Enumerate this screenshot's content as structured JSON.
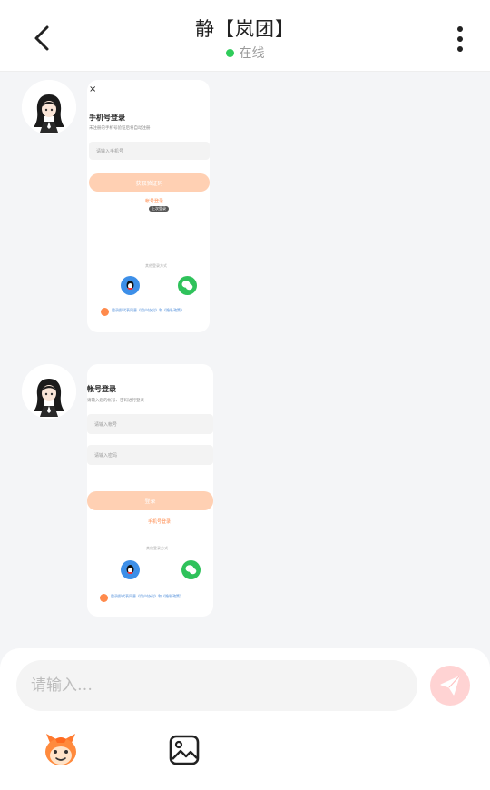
{
  "header": {
    "title": "静【岚团】",
    "status": "在线",
    "status_color": "#2fcc5a",
    "back_icon": "chevron-left-icon",
    "more_icon": "more-vertical-icon"
  },
  "messages": [
    {
      "avatar_icon": "anime-girl-avatar",
      "screenshot": {
        "close_glyph": "×",
        "heading": "手机号登录",
        "subtitle": "未注册的手机号验证后将自动注册",
        "phone_placeholder": "请输入手机号",
        "submit_label": "获取验证码",
        "alt_login": "帐号登录",
        "alt_tag": "上次登录",
        "divider_text": "其他登录方式",
        "agreement": "登录即代表同意《用户协议》和《隐私政策》"
      }
    },
    {
      "avatar_icon": "anime-girl-avatar",
      "screenshot": {
        "heading": "帐号登录",
        "subtitle": "请输入您的帐号、密码进行登录",
        "account_placeholder": "请输入帐号",
        "password_placeholder": "请输入密码",
        "submit_label": "登录",
        "alt_login": "手机号登录",
        "divider_text": "其他登录方式",
        "agreement": "登录即代表同意《用户协议》和《隐私政策》"
      }
    }
  ],
  "composer": {
    "placeholder": "请输入…",
    "value": "",
    "send_icon": "paper-plane-icon",
    "tools": [
      {
        "name": "mascot-sticker-icon"
      },
      {
        "name": "image-gallery-icon"
      }
    ]
  },
  "colors": {
    "accent": "#ff8a4c",
    "accent_light": "#ffd0b3",
    "qq": "#3d8fe8",
    "wechat": "#2fc25b",
    "send_bg": "#ffd3d3"
  }
}
